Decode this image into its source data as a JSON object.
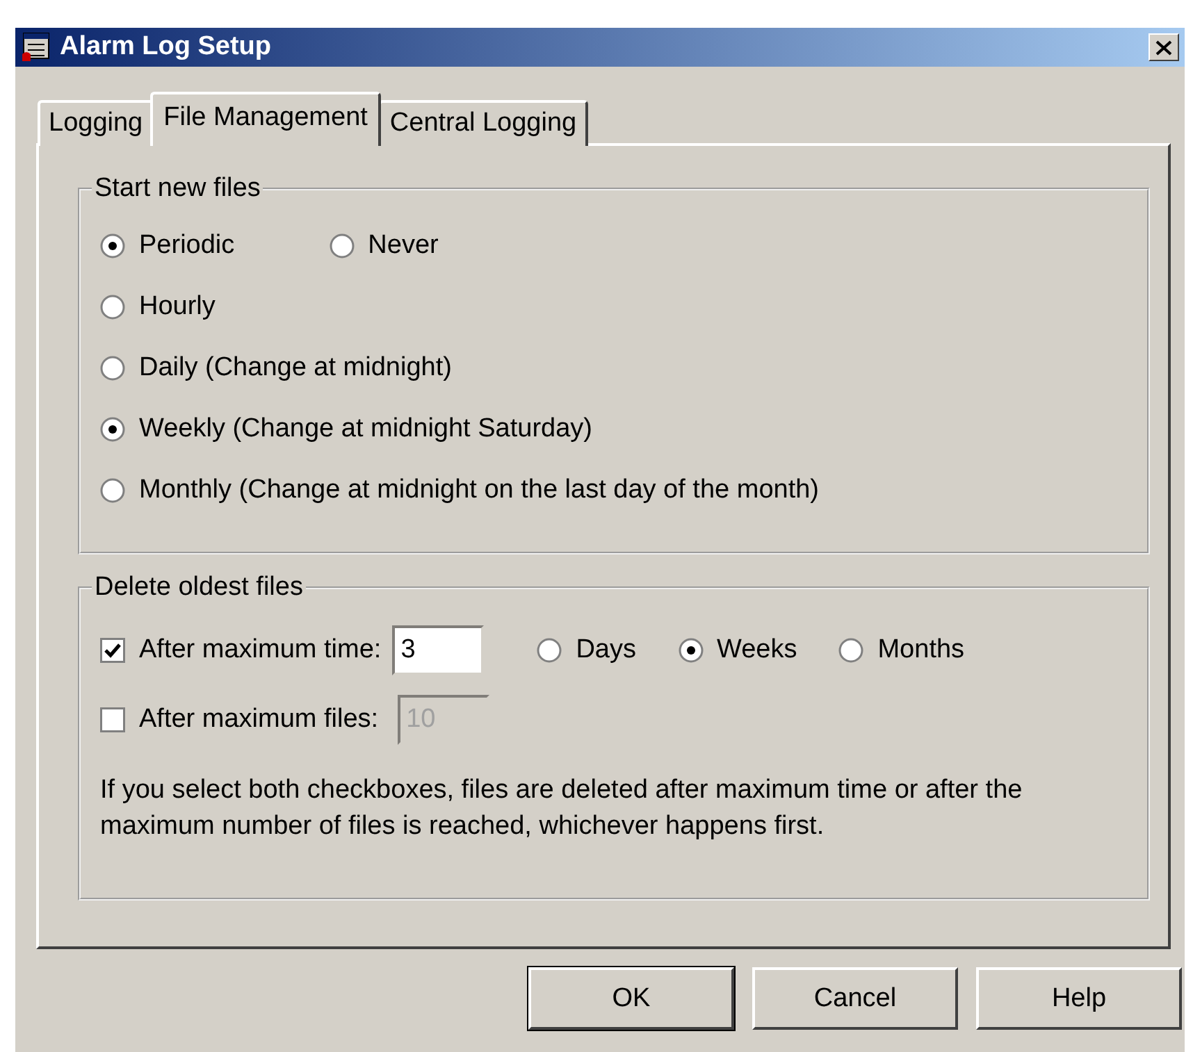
{
  "window": {
    "title": "Alarm Log Setup"
  },
  "tabs": [
    {
      "label": "Logging",
      "selected": false
    },
    {
      "label": "File Management",
      "selected": true
    },
    {
      "label": "Central Logging",
      "selected": false
    }
  ],
  "start_new_files": {
    "title": "Start new files",
    "modes": [
      {
        "label": "Periodic",
        "selected": true
      },
      {
        "label": "Never",
        "selected": false
      }
    ],
    "periods": [
      {
        "label": "Hourly",
        "selected": false
      },
      {
        "label": "Daily (Change at midnight)",
        "selected": false
      },
      {
        "label": "Weekly (Change at midnight Saturday)",
        "selected": true
      },
      {
        "label": "Monthly (Change at midnight on the last day of the month)",
        "selected": false
      }
    ]
  },
  "delete_oldest_files": {
    "title": "Delete oldest files",
    "max_time": {
      "label": "After maximum time:",
      "checked": true,
      "value": "3",
      "disabled": false
    },
    "units": [
      {
        "label": "Days",
        "selected": false
      },
      {
        "label": "Weeks",
        "selected": true
      },
      {
        "label": "Months",
        "selected": false
      }
    ],
    "max_files": {
      "label": "After maximum files:",
      "checked": false,
      "value": "10",
      "disabled": true
    },
    "note": "If you select both checkboxes, files are deleted after maximum time or after the maximum number of files is reached, whichever happens first."
  },
  "buttons": [
    {
      "label": "OK",
      "default": true
    },
    {
      "label": "Cancel",
      "default": false
    },
    {
      "label": "Help",
      "default": false
    }
  ]
}
